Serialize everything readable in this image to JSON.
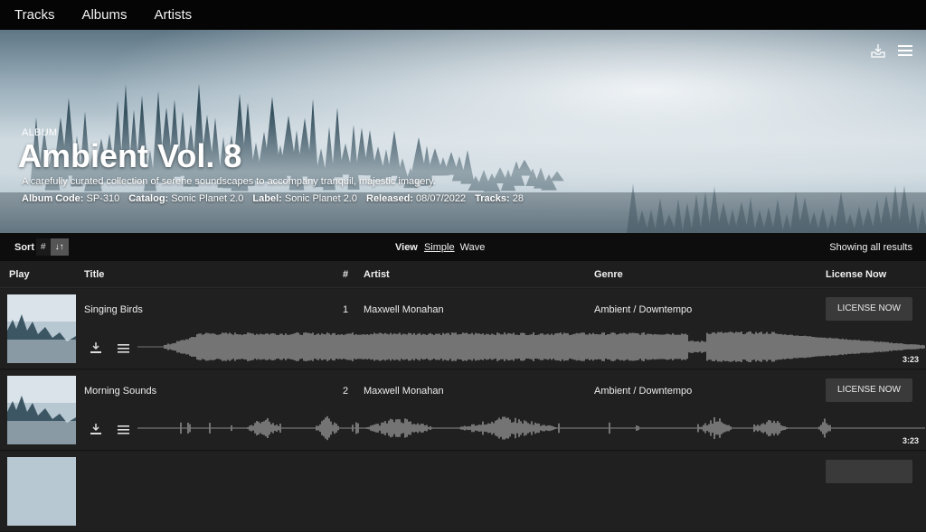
{
  "nav": {
    "items": [
      "Tracks",
      "Albums",
      "Artists"
    ]
  },
  "hero": {
    "kicker": "ALBUM",
    "title": "Ambient Vol. 8",
    "description": "A carefully curated collection of serene soundscapes to accompany tranquil, majestic imagery.",
    "meta": {
      "album_code_label": "Album Code:",
      "album_code": "SP-310",
      "catalog_label": "Catalog:",
      "catalog": "Sonic Planet 2.0",
      "label_label": "Label:",
      "label": "Sonic Planet 2.0",
      "released_label": "Released:",
      "released": "08/07/2022",
      "tracks_label": "Tracks:",
      "tracks": "28"
    },
    "tools": {
      "download_icon": "tray-download-icon",
      "menu_icon": "hamburger-menu-icon"
    }
  },
  "sortbar": {
    "sort_label": "Sort",
    "sort_num": "#",
    "sort_order": "↓↑",
    "view_label": "View",
    "view_simple": "Simple",
    "view_wave": "Wave",
    "results": "Showing all results"
  },
  "table": {
    "headers": {
      "play": "Play",
      "title": "Title",
      "num": "#",
      "artist": "Artist",
      "genre": "Genre",
      "license": "License Now"
    },
    "rows": [
      {
        "title": "Singing Birds",
        "num": "1",
        "artist": "Maxwell Monahan",
        "genre": "Ambient / Downtempo",
        "license": "LICENSE NOW",
        "duration": "3:23"
      },
      {
        "title": "Morning Sounds",
        "num": "2",
        "artist": "Maxwell Monahan",
        "genre": "Ambient / Downtempo",
        "license": "LICENSE NOW",
        "duration": "3:23"
      }
    ]
  },
  "colors": {
    "nav_bg": "#050505",
    "row_bg": "#202020",
    "button_bg": "#3a3a3a",
    "wave": "#8a8a8a"
  }
}
